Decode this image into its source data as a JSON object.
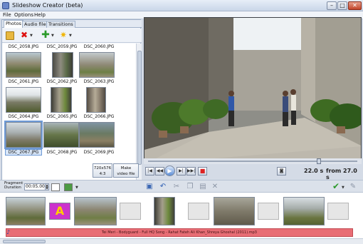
{
  "window": {
    "title": "Slideshow Creator (beta)",
    "buttons": {
      "minimize": "–",
      "maximize": "□",
      "close": "✕"
    }
  },
  "menu": [
    "File",
    "Options",
    "Help"
  ],
  "tabs": [
    "Photos",
    "Audio files",
    "Transitions"
  ],
  "gallery": {
    "captions": [
      "DSC_2058.JPG",
      "DSC_2059.JPG",
      "DSC_2060.JPG",
      "DSC_2061.JPG",
      "DSC_2062.JPG",
      "DSC_2063.JPG",
      "DSC_2064.JPG",
      "DSC_2065.JPG",
      "DSC_2066.JPG",
      "DSC_2067.JPG",
      "DSC_2068.JPG",
      "DSC_2069.JPG"
    ],
    "selected": "DSC_2067.JPG"
  },
  "buttons": {
    "resolution_line1": "720x576",
    "resolution_line2": "4:3",
    "make_video_line1": "Make",
    "make_video_line2": "video file"
  },
  "player": {
    "current_time": "22.0 s",
    "total_time": "from 27.0 s",
    "progress": 0.815,
    "icons": {
      "prev": "|◀",
      "rewind": "◀◀",
      "play": "▶",
      "forward": "▶|",
      "next": "▶▶|",
      "stop": "■"
    }
  },
  "timeline_toolbar": {
    "fragment_label_1": "Fragment",
    "fragment_label_2": "Duration",
    "duration_value": "00:05.000"
  },
  "audio": {
    "label": "Tei Meri - Bodyguard - Full HQ Song - Rahat Fateh Ali Khan_Shreya Ghoshal (2011).mp3"
  },
  "colors": {
    "audio_track": "#e86d75",
    "selection": "#6e9ad6",
    "accent": "#5d8ed6"
  }
}
